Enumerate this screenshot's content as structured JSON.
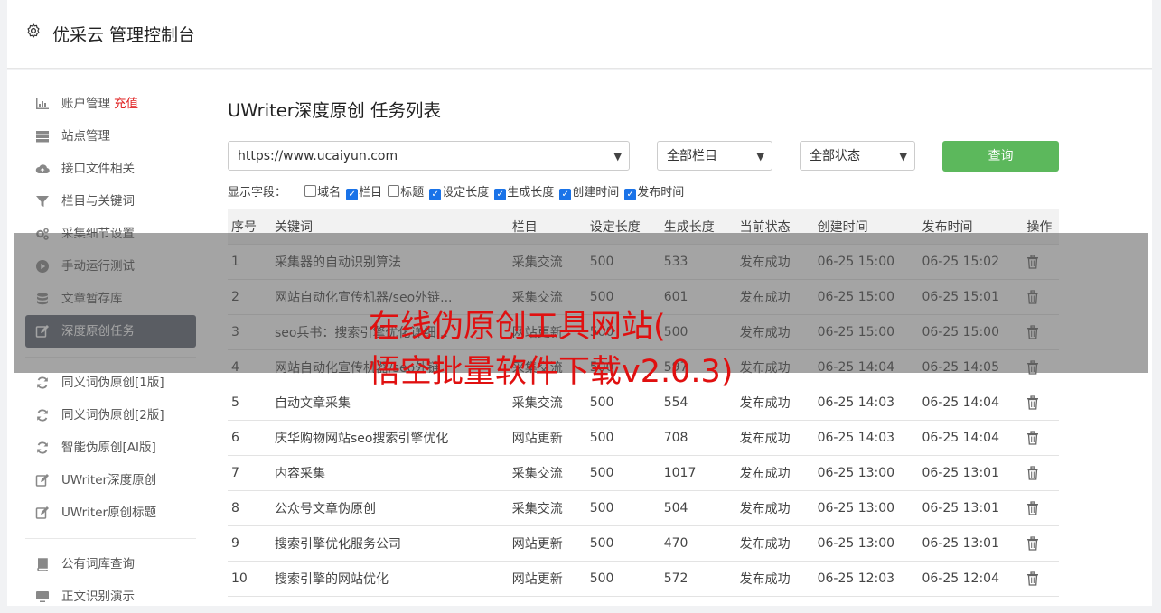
{
  "app": {
    "title": "优采云 管理控制台"
  },
  "sidebar": {
    "groups": [
      [
        {
          "label": "账户管理",
          "extra": "充值",
          "icon": "bar-chart-icon"
        },
        {
          "label": "站点管理",
          "icon": "server-icon"
        },
        {
          "label": "接口文件相关",
          "icon": "cloud-upload-icon"
        },
        {
          "label": "栏目与关键词",
          "icon": "filter-icon"
        },
        {
          "label": "采集细节设置",
          "icon": "gears-icon"
        },
        {
          "label": "手动运行测试",
          "icon": "play-circle-icon"
        },
        {
          "label": "文章暂存库",
          "icon": "database-icon"
        },
        {
          "label": "深度原创任务",
          "icon": "edit-icon",
          "active": true
        }
      ],
      [
        {
          "label": "同义词伪原创[1版]",
          "icon": "refresh-icon"
        },
        {
          "label": "同义词伪原创[2版]",
          "icon": "refresh-icon"
        },
        {
          "label": "智能伪原创[AI版]",
          "icon": "refresh-icon"
        },
        {
          "label": "UWriter深度原创",
          "icon": "edit-icon"
        },
        {
          "label": "UWriter原创标题",
          "icon": "edit-icon"
        }
      ],
      [
        {
          "label": "公有词库查询",
          "icon": "book-icon"
        },
        {
          "label": "正文识别演示",
          "icon": "monitor-icon"
        }
      ]
    ]
  },
  "main": {
    "title": "UWriter深度原创 任务列表",
    "site_select": "https://www.ucaiyun.com",
    "column_select": "全部栏目",
    "status_select": "全部状态",
    "query_label": "查询",
    "fields_label": "显示字段：",
    "fields": [
      {
        "label": "域名",
        "checked": false
      },
      {
        "label": "栏目",
        "checked": true
      },
      {
        "label": "标题",
        "checked": false
      },
      {
        "label": "设定长度",
        "checked": true
      },
      {
        "label": "生成长度",
        "checked": true
      },
      {
        "label": "创建时间",
        "checked": true
      },
      {
        "label": "发布时间",
        "checked": true
      }
    ],
    "table": {
      "headers": [
        "序号",
        "关键词",
        "栏目",
        "设定长度",
        "生成长度",
        "当前状态",
        "创建时间",
        "发布时间",
        "操作"
      ],
      "rows": [
        [
          "1",
          "采集器的自动识别算法",
          "采集交流",
          "500",
          "533",
          "发布成功",
          "06-25 15:00",
          "06-25 15:02"
        ],
        [
          "2",
          "网站自动化宣传机器/seo外链...",
          "采集交流",
          "500",
          "601",
          "发布成功",
          "06-25 15:00",
          "06-25 15:01"
        ],
        [
          "3",
          "seo兵书：搜索引擎优化详细...",
          "网站更新",
          "500",
          "500",
          "发布成功",
          "06-25 15:00",
          "06-25 15:00"
        ],
        [
          "4",
          "网站自动化宣传机器/seo外链",
          "采集交流",
          "500",
          "597",
          "发布成功",
          "06-25 14:04",
          "06-25 14:05"
        ],
        [
          "5",
          "自动文章采集",
          "采集交流",
          "500",
          "554",
          "发布成功",
          "06-25 14:03",
          "06-25 14:04"
        ],
        [
          "6",
          "庆华购物网站seo搜索引擎优化",
          "网站更新",
          "500",
          "708",
          "发布成功",
          "06-25 14:03",
          "06-25 14:04"
        ],
        [
          "7",
          "内容采集",
          "采集交流",
          "500",
          "1017",
          "发布成功",
          "06-25 13:00",
          "06-25 13:01"
        ],
        [
          "8",
          "公众号文章伪原创",
          "采集交流",
          "500",
          "504",
          "发布成功",
          "06-25 13:00",
          "06-25 13:01"
        ],
        [
          "9",
          "搜索引擎优化服务公司",
          "网站更新",
          "500",
          "470",
          "发布成功",
          "06-25 13:00",
          "06-25 13:01"
        ],
        [
          "10",
          "搜索引擎的网站优化",
          "网站更新",
          "500",
          "572",
          "发布成功",
          "06-25 12:03",
          "06-25 12:04"
        ]
      ]
    }
  },
  "overlay": {
    "line1": "在线伪原创工具网站(",
    "line2": "悟空批量软件下载v2.0.3)"
  }
}
